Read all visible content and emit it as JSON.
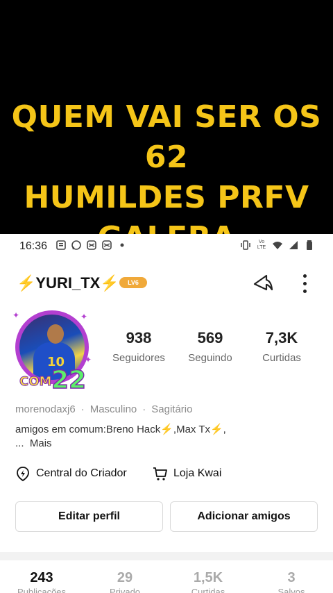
{
  "banner": {
    "line1": "QUEM VAI SER OS 62",
    "line2": "HUMILDES PRFV",
    "line3": "GALERA",
    "text_color": "#f5c518"
  },
  "status_bar": {
    "time": "16:36",
    "left_icons": [
      "gallery-icon",
      "whatsapp-icon",
      "capcut-icon",
      "capcut-icon",
      "dot-icon"
    ],
    "right_icons": [
      "vibrate-icon",
      "volte-icon",
      "wifi-icon",
      "signal-icon",
      "battery-icon"
    ],
    "volte_text": "Vo LTE"
  },
  "header": {
    "username": "YURI_TX",
    "bolt": "⚡",
    "level": "LV6",
    "level_color": "#f0a93a"
  },
  "avatar": {
    "jersey_number": "10",
    "frame_text_com": "COM",
    "frame_text_num": "22",
    "frame_color": "#b33fd0"
  },
  "stats": [
    {
      "value": "938",
      "label": "Seguidores"
    },
    {
      "value": "569",
      "label": "Seguindo"
    },
    {
      "value": "7,3K",
      "label": "Curtidas"
    }
  ],
  "meta": {
    "handle": "morenodaxj6",
    "gender": "Masculino",
    "sign": "Sagitário",
    "separator": "·"
  },
  "common_friends": {
    "text": "amigos em comum:Breno Hack⚡,Max Tx⚡,",
    "ellipsis": "...",
    "more": "Mais"
  },
  "links": {
    "creator_center": "Central do Criador",
    "shop": "Loja Kwai"
  },
  "buttons": {
    "edit_profile": "Editar perfil",
    "add_friends": "Adicionar amigos"
  },
  "tabs": [
    {
      "value": "243",
      "label": "Publicações"
    },
    {
      "value": "29",
      "label": "Privado"
    },
    {
      "value": "1,5K",
      "label": "Curtidas"
    },
    {
      "value": "3",
      "label": "Salvos"
    }
  ]
}
